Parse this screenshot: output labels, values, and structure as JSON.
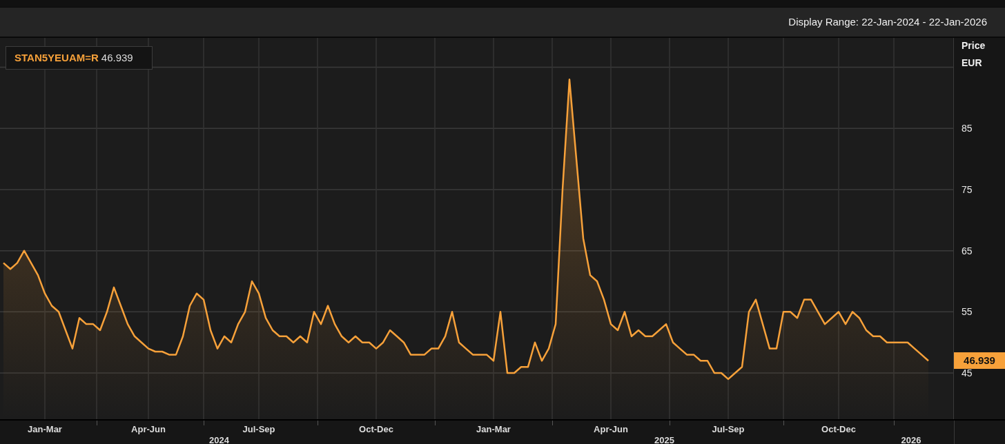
{
  "header": {
    "display_range": "Display Range: 22-Jan-2024 - 22-Jan-2026"
  },
  "legend": {
    "value": "46.939"
  },
  "axis_title": {
    "line1": "Price",
    "line2": "EUR"
  },
  "last_price": "46.939",
  "chart_data": {
    "type": "area",
    "grid": true,
    "ylim": [
      37.45,
      99.8
    ],
    "yticks": [
      45,
      55,
      65,
      75,
      85
    ],
    "annotations": [
      "2024",
      "2025",
      "2026"
    ],
    "categories": [
      null,
      null,
      null,
      null,
      null,
      null,
      "Jan-Mar",
      null,
      null,
      null,
      null,
      null,
      null,
      null,
      null,
      null,
      null,
      null,
      null,
      null,
      null,
      "Apr-Jun",
      null,
      null,
      null,
      null,
      null,
      null,
      null,
      null,
      null,
      null,
      null,
      null,
      null,
      null,
      null,
      "Jul-Sep",
      null,
      null,
      null,
      null,
      null,
      null,
      null,
      null,
      null,
      null,
      null,
      null,
      null,
      null,
      null,
      null,
      "Oct-Dec",
      null,
      null,
      null,
      null,
      null,
      null,
      null,
      null,
      null,
      null,
      null,
      null,
      null,
      null,
      null,
      null,
      "Jan-Mar",
      null,
      null,
      null,
      null,
      null,
      null,
      null,
      null,
      null,
      null,
      null,
      null,
      null,
      null,
      null,
      null,
      "Apr-Jun",
      null,
      null,
      null,
      null,
      null,
      null,
      null,
      null,
      null,
      null,
      null,
      null,
      null,
      null,
      null,
      null,
      "Jul-Sep",
      null,
      null,
      null,
      null,
      null,
      null,
      null,
      null,
      null,
      null,
      null,
      null,
      null,
      null,
      null,
      "Oct-Dec",
      null,
      null,
      null,
      null,
      null,
      null,
      null,
      null,
      null,
      null,
      null,
      null,
      null
    ],
    "series": [
      {
        "name": "STAN5YEUAM=R",
        "color": "#f7a13a",
        "values": [
          63,
          62,
          63,
          65,
          63,
          61,
          58,
          56,
          55,
          52,
          49,
          54,
          53,
          53,
          52,
          55,
          59,
          56,
          53,
          51,
          50,
          49,
          48.5,
          48.5,
          48,
          48,
          51,
          56,
          58,
          57,
          52,
          49,
          51,
          50,
          53,
          55,
          60,
          58,
          54,
          52,
          51,
          51,
          50,
          51,
          50,
          55,
          53,
          56,
          53,
          51,
          50,
          51,
          50,
          50,
          49,
          50,
          52,
          51,
          50,
          48,
          48,
          48,
          49,
          49,
          51,
          55,
          50,
          49,
          48,
          48,
          48,
          47,
          55,
          45,
          45,
          46,
          46,
          50,
          47,
          49,
          53,
          75,
          93,
          80,
          67,
          61,
          60,
          57,
          53,
          52,
          55,
          51,
          52,
          51,
          51,
          52,
          53,
          50,
          49,
          48,
          48,
          47,
          47,
          45,
          45,
          44,
          45,
          46,
          55,
          57,
          53,
          49,
          49,
          55,
          55,
          54,
          57,
          57,
          55,
          53,
          54,
          55,
          53,
          55,
          54,
          52,
          51,
          51,
          50,
          50,
          50,
          50,
          49,
          48,
          47
        ]
      }
    ]
  }
}
